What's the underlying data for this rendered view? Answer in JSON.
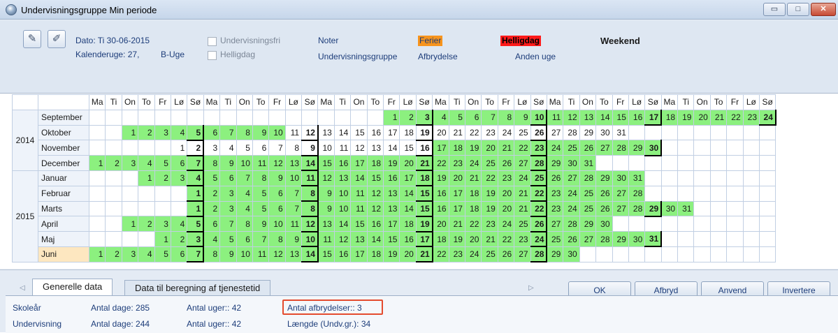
{
  "window": {
    "title": "Undervisningsgruppe Min periode",
    "controls": {
      "minimize": "▭",
      "maximize": "□",
      "close": "✕"
    }
  },
  "toolbar": {
    "icons": [
      "notepad-icon",
      "edit-pencil-icon"
    ],
    "date": "Dato: Ti 30-06-2015",
    "week": "Kalenderuge: 27,",
    "week_type": "B-Uge",
    "check1": "Undervisningsfri",
    "check2": "Helligdag",
    "legend": {
      "noter": "Noter",
      "ferier": "Ferier",
      "helligdag": "Helligdag",
      "weekend": "Weekend",
      "undervisningsgruppe": "Undervisningsgruppe",
      "afbrydelse": "Afbrydelse",
      "anden_uge": "Anden uge"
    },
    "colors": {
      "ferier_bg": "#f7941d",
      "helligdag_bg": "#ff1a1a",
      "lesson_green": "#8cf07f"
    }
  },
  "calendar": {
    "weekdays": [
      "Ma",
      "Ti",
      "On",
      "To",
      "Fr",
      "Lø",
      "Sø",
      "Ma",
      "Ti",
      "On",
      "To",
      "Fr",
      "Lø",
      "Sø",
      "Ma",
      "Ti",
      "On",
      "To",
      "Fr",
      "Lø",
      "Sø",
      "Ma",
      "Ti",
      "On",
      "To",
      "Fr",
      "Lø",
      "Sø",
      "Ma",
      "Ti",
      "On",
      "To",
      "Fr",
      "Lø",
      "Sø",
      "Ma",
      "Ti",
      "On",
      "To",
      "Fr",
      "Lø",
      "Sø"
    ],
    "years": [
      {
        "label": "2014",
        "months": 4
      },
      {
        "label": "2015",
        "months": 6
      }
    ],
    "months": [
      {
        "name": "September",
        "offset": 18,
        "days": 30,
        "green_from": 1
      },
      {
        "name": "Oktober",
        "offset": 2,
        "days": 31,
        "green_from": 1,
        "green_to": 10
      },
      {
        "name": "November",
        "offset": 5,
        "days": 30,
        "green_from": 17
      },
      {
        "name": "December",
        "offset": 0,
        "days": 31,
        "green_from": 1
      },
      {
        "name": "Januar",
        "offset": 3,
        "days": 31,
        "green_from": 1
      },
      {
        "name": "Februar",
        "offset": 6,
        "days": 28,
        "green_from": 1
      },
      {
        "name": "Marts",
        "offset": 6,
        "days": 31,
        "green_from": 1
      },
      {
        "name": "April",
        "offset": 2,
        "days": 30,
        "green_from": 1
      },
      {
        "name": "Maj",
        "offset": 4,
        "days": 31,
        "green_from": 1
      },
      {
        "name": "Juni",
        "offset": 0,
        "days": 30,
        "green_from": 1,
        "selected": true
      }
    ]
  },
  "tabs": {
    "generelle": "Generelle data",
    "tjenestetid": "Data til beregning af tjenestetid"
  },
  "summary": {
    "row1": {
      "label": "Skoleår",
      "dage": "Antal dage: 285",
      "uger": "Antal uger:: 42",
      "afbrydelser": "Antal afbrydelser:: 3"
    },
    "row2": {
      "label": "Undervisning",
      "dage": "Antal dage: 244",
      "uger": "Antal uger:: 42",
      "laengde": "Længde (Undv.gr.): 34"
    }
  },
  "buttons": {
    "ok": "OK",
    "afbryd": "Afbryd",
    "anvend": "Anvend",
    "invertere": "Invertere"
  }
}
